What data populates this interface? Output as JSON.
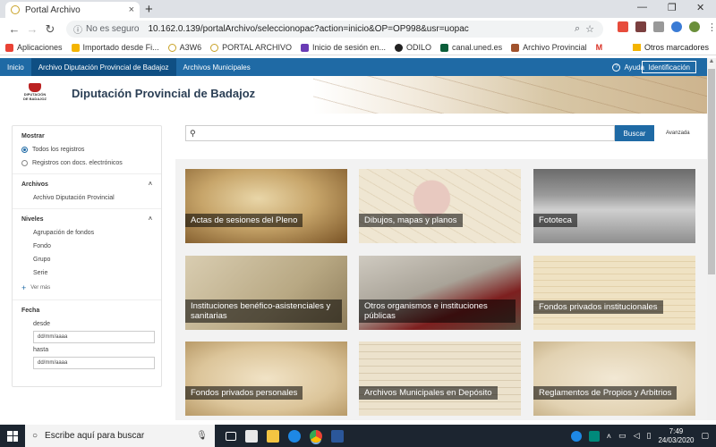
{
  "browser": {
    "tab_title": "Portal Archivo",
    "tab_close": "×",
    "new_tab": "+",
    "security_label": "No es seguro",
    "url": "10.162.0.139/portalArchivo/seleccionopac?action=inicio&OP=OP998&usr=uopac",
    "window_controls": [
      "—",
      "❐",
      "✕"
    ]
  },
  "bookmarks": {
    "items": [
      {
        "label": "Aplicaciones",
        "color": "#e94235"
      },
      {
        "label": "Importado desde Fi...",
        "color": "#f4b400"
      },
      {
        "label": "A3W6",
        "color": "#c9a227"
      },
      {
        "label": "PORTAL ARCHIVO",
        "color": "#c9a227"
      },
      {
        "label": "Inicio de sesión en...",
        "color": "#6a3cb5"
      },
      {
        "label": "ODILO",
        "color": "#222222"
      },
      {
        "label": "canal.uned.es",
        "color": "#0b5e3a"
      },
      {
        "label": "Archivo Provincial",
        "color": "#a0522d"
      },
      {
        "label": "M",
        "color": "#d93025"
      }
    ],
    "other": "Otros marcadores"
  },
  "portal_nav": {
    "items": [
      "Inicio",
      "Archivo Diputación Provincial de Badajoz",
      "Archivos Municipales"
    ],
    "ayuda": "Ayuda",
    "identificacion": "Identificación"
  },
  "header": {
    "logo_text": "DIPUTACIÓN DE BADAJOZ",
    "title": "Diputación Provincial de Badajoz"
  },
  "sidebar": {
    "mostrar": {
      "title": "Mostrar",
      "options": [
        "Todos los registros",
        "Registros con docs. electrónicos"
      ],
      "selected": 0
    },
    "archivos": {
      "title": "Archivos",
      "items": [
        "Archivo Diputación Provincial"
      ]
    },
    "niveles": {
      "title": "Niveles",
      "items": [
        "Agrupación de fondos",
        "Fondo",
        "Grupo",
        "Serie"
      ],
      "more": "Ver más"
    },
    "fecha": {
      "title": "Fecha",
      "desde_label": "desde",
      "desde_value": "dd/mm/aaaa",
      "hasta_label": "hasta",
      "hasta_value": "dd/mm/aaaa"
    }
  },
  "search": {
    "placeholder": "",
    "button": "Buscar",
    "advanced": "Avanzada"
  },
  "cards": [
    {
      "label": "Actas de sesiones del Pleno"
    },
    {
      "label": "Dibujos, mapas y planos"
    },
    {
      "label": "Fototeca"
    },
    {
      "label": "Instituciones benéfico-asistenciales y sanitarias"
    },
    {
      "label": "Otros organismos e instituciones públicas"
    },
    {
      "label": "Fondos privados institucionales"
    },
    {
      "label": "Fondos privados personales"
    },
    {
      "label": "Archivos Municipales en Depósito"
    },
    {
      "label": "Reglamentos de Propios y Arbitrios"
    }
  ],
  "taskbar": {
    "search_placeholder": "Escribe aquí para buscar",
    "time": "7:49",
    "date": "24/03/2020"
  }
}
